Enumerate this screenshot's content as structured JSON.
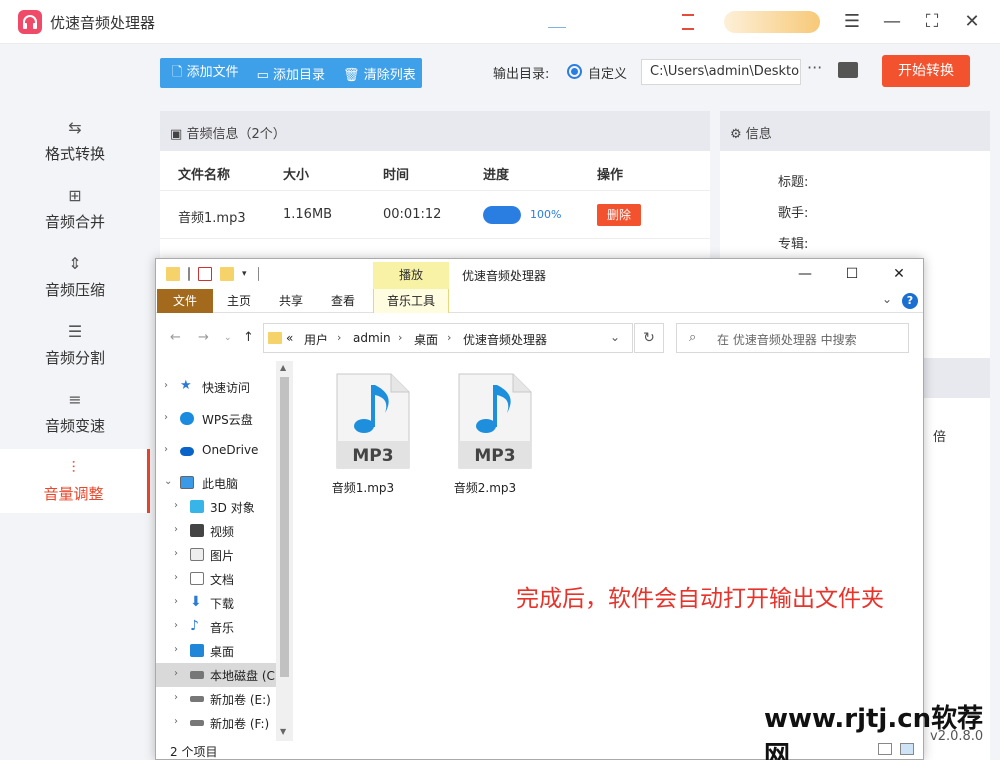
{
  "app": {
    "title": "优速音频处理器",
    "version": "v2.0.8.0"
  },
  "sidebar": {
    "items": [
      {
        "label": "格式转换",
        "icon": "format-convert-icon"
      },
      {
        "label": "音频合并",
        "icon": "merge-icon"
      },
      {
        "label": "音频压缩",
        "icon": "compress-icon"
      },
      {
        "label": "音频分割",
        "icon": "split-icon"
      },
      {
        "label": "音频变速",
        "icon": "speed-icon"
      },
      {
        "label": "音量调整",
        "icon": "volume-icon",
        "active": true
      }
    ]
  },
  "toolbar": {
    "add_file": "添加文件",
    "add_folder": "添加目录",
    "clear_list": "清除列表",
    "output_label": "输出目录:",
    "radio_custom": "自定义",
    "output_path": "C:\\Users\\admin\\Desktop",
    "more": "···",
    "start": "开始转换"
  },
  "audio_panel": {
    "title": "音频信息（2个）",
    "columns": [
      "文件名称",
      "大小",
      "时间",
      "进度",
      "操作"
    ],
    "rows": [
      {
        "name": "音频1.mp3",
        "size": "1.16MB",
        "time": "00:01:12",
        "progress": 1.0,
        "progress_text": "100%",
        "action": "删除"
      }
    ]
  },
  "info_panel": {
    "title": "信息",
    "fields": [
      "标题:",
      "歌手:",
      "专辑:"
    ],
    "multiplier": "倍"
  },
  "explorer": {
    "tab_play": "播放",
    "title": "优速音频处理器",
    "ribbon_tabs": [
      "文件",
      "主页",
      "共享",
      "查看",
      "音乐工具"
    ],
    "breadcrumb": [
      "«",
      "用户",
      "admin",
      "桌面",
      "优速音频处理器"
    ],
    "search_placeholder": "在 优速音频处理器 中搜索",
    "nav_items": [
      {
        "label": "快速访问",
        "icon": "star-icon"
      },
      {
        "label": "WPS云盘",
        "icon": "cloud-icon"
      },
      {
        "label": "OneDrive",
        "icon": "onedrive-icon"
      },
      {
        "label": "此电脑",
        "icon": "pc-icon"
      },
      {
        "label": "3D 对象",
        "icon": "3d-icon"
      },
      {
        "label": "视频",
        "icon": "video-icon"
      },
      {
        "label": "图片",
        "icon": "picture-icon"
      },
      {
        "label": "文档",
        "icon": "document-icon"
      },
      {
        "label": "下载",
        "icon": "download-icon"
      },
      {
        "label": "音乐",
        "icon": "music-icon"
      },
      {
        "label": "桌面",
        "icon": "desktop-icon"
      },
      {
        "label": "本地磁盘 (C:",
        "icon": "disk-icon",
        "selected": true
      },
      {
        "label": "新加卷 (E:)",
        "icon": "drive-icon"
      },
      {
        "label": "新加卷 (F:)",
        "icon": "drive-icon"
      }
    ],
    "files": [
      {
        "name": "音频1.mp3",
        "badge": "MP3"
      },
      {
        "name": "音频2.mp3",
        "badge": "MP3"
      }
    ],
    "note": "完成后，软件会自动打开输出文件夹",
    "status": "2 个项目"
  },
  "watermark": "www.rjtj.cn软荐网",
  "colors": {
    "accent_red": "#f2522e",
    "toolbar_blue": "#3ea0e8",
    "progress_blue": "#2a7de1",
    "note_red": "#e8332a"
  }
}
